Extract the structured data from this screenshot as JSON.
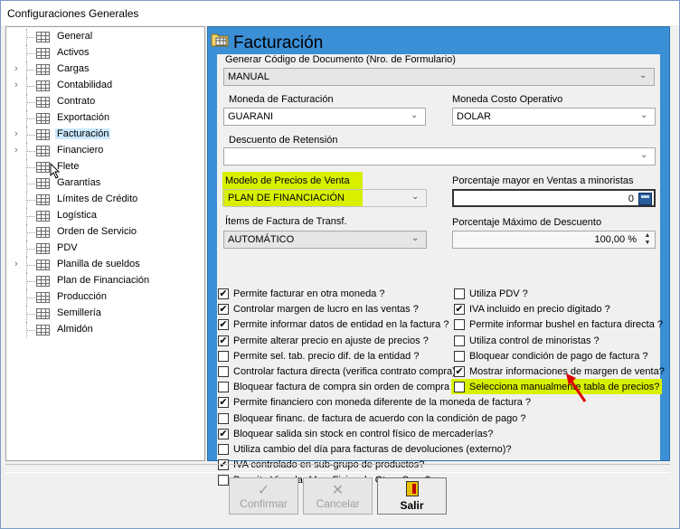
{
  "window": {
    "title": "Configuraciones Generales"
  },
  "tree": {
    "items": [
      {
        "label": "General",
        "expandable": false
      },
      {
        "label": "Activos",
        "expandable": false
      },
      {
        "label": "Cargas",
        "expandable": true
      },
      {
        "label": "Contabilidad",
        "expandable": true
      },
      {
        "label": "Contrato",
        "expandable": false
      },
      {
        "label": "Exportación",
        "expandable": false
      },
      {
        "label": "Facturación",
        "expandable": true,
        "selected": true
      },
      {
        "label": "Financiero",
        "expandable": true
      },
      {
        "label": "Flete",
        "expandable": false
      },
      {
        "label": "Garantías",
        "expandable": false
      },
      {
        "label": "Límites de Crédito",
        "expandable": false
      },
      {
        "label": "Logística",
        "expandable": false
      },
      {
        "label": "Orden de Servicio",
        "expandable": false
      },
      {
        "label": "PDV",
        "expandable": false
      },
      {
        "label": "Planilla de sueldos",
        "expandable": true
      },
      {
        "label": "Plan de Financiación",
        "expandable": false
      },
      {
        "label": "Producción",
        "expandable": false
      },
      {
        "label": "Semillería",
        "expandable": false
      },
      {
        "label": "Almidón",
        "expandable": false
      }
    ]
  },
  "panel": {
    "title": "Facturación",
    "fields": {
      "codigo_documento": {
        "label": "Generar Código de Documento (Nro. de Formulario)",
        "value": "MANUAL"
      },
      "moneda_facturacion": {
        "label": "Moneda de Facturación",
        "value": "GUARANI"
      },
      "moneda_costo": {
        "label": "Moneda Costo Operativo",
        "value": "DOLAR"
      },
      "descuento_retension": {
        "label": "Descuento de Retensión",
        "value": ""
      },
      "modelo_precios": {
        "label": "Modelo de Precios de Venta",
        "value": "PLAN DE FINANCIACIÓN"
      },
      "porcentaje_mayor": {
        "label": "Porcentaje mayor en Ventas a minoristas",
        "value": "0"
      },
      "items_factura": {
        "label": "Ítems de Factura de Transf.",
        "value": "AUTOMÁTICO"
      },
      "porcentaje_descuento": {
        "label": "Porcentaje Máximo de Descuento",
        "value": "100,00 %"
      }
    },
    "checks_left": [
      {
        "label": "Permite facturar en otra moneda ?",
        "checked": true
      },
      {
        "label": "Controlar margen de lucro en las ventas ?",
        "checked": true
      },
      {
        "label": "Permite  informar datos de entidad en la factura ?",
        "checked": true
      },
      {
        "label": "Permite alterar precio en ajuste de precios ?",
        "checked": true
      },
      {
        "label": "Permite sel. tab. precio dif. de la entidad ?",
        "checked": false
      },
      {
        "label": "Controlar factura directa (verifica contrato compra)",
        "checked": false
      },
      {
        "label": "Bloquear factura de compra sin orden de compra ?",
        "checked": false
      },
      {
        "label": "Permite financiero con moneda diferente de la moneda de factura ?",
        "checked": true
      },
      {
        "label": "Bloquear financ. de factura de acuerdo con la condición de pago ?",
        "checked": false
      },
      {
        "label": "Bloquear salida sin stock en control físico de mercaderías?",
        "checked": true
      },
      {
        "label": "Utiliza cambio del día para facturas de devoluciones (externo)?",
        "checked": false
      },
      {
        "label": "IVA controlado en sub-grupo de productos?",
        "checked": true
      },
      {
        "label": "Permite Vincular Mov. Fisico de Otras Suc. ?",
        "checked": false
      }
    ],
    "checks_right": [
      {
        "label": "Utiliza PDV ?",
        "checked": false
      },
      {
        "label": "IVA incluido en precio digitado ?",
        "checked": true
      },
      {
        "label": "Permite informar bushel en factura directa ?",
        "checked": false
      },
      {
        "label": "Utiliza control de minoristas ?",
        "checked": false
      },
      {
        "label": "Bloquear condición de pago de factura ?",
        "checked": false
      },
      {
        "label": "Mostrar informaciones de margen de venta?",
        "checked": true
      },
      {
        "label": "Selecciona manualmente tabla de precios?",
        "checked": false,
        "highlight": true
      }
    ],
    "highlight_color": "#d8f000"
  },
  "buttons": {
    "confirm": "Confirmar",
    "cancel": "Cancelar",
    "exit": "Salir"
  }
}
